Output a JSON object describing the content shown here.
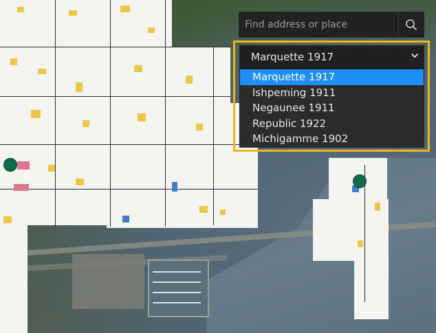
{
  "search": {
    "placeholder": "Find address or place",
    "icon": "search-icon"
  },
  "selector": {
    "selected": "Marquette 1917",
    "options": [
      {
        "label": "Marquette 1917",
        "selected": true
      },
      {
        "label": "Ishpeming 1911",
        "selected": false
      },
      {
        "label": "Negaunee 1911",
        "selected": false
      },
      {
        "label": "Republic 1922",
        "selected": false
      },
      {
        "label": "Michigamme 1902",
        "selected": false
      }
    ],
    "highlight_color": "#f5b21b",
    "selected_color": "#1e8ff5"
  },
  "map": {
    "marker_color": "#0f6b4a"
  }
}
